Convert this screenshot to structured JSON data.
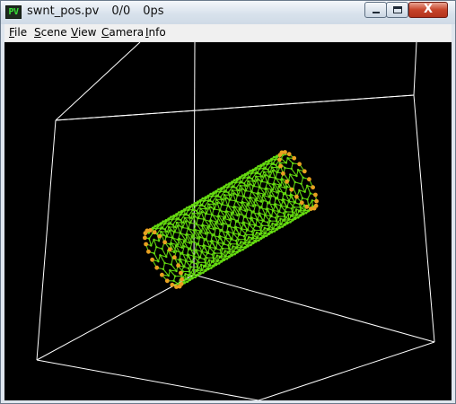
{
  "window": {
    "app_icon_text": "PV",
    "title_segments": [
      "swnt_pos.pv",
      "0/0",
      "0ps"
    ],
    "close_glyph": "X"
  },
  "menu": [
    {
      "accel": "F",
      "rest": "ile"
    },
    {
      "accel": "S",
      "rest": "cene"
    },
    {
      "accel": "V",
      "rest": "iew"
    },
    {
      "accel": "C",
      "rest": "amera"
    },
    {
      "accel": "I",
      "rest": "nfo"
    }
  ],
  "viewport": {
    "background": "#000000",
    "box_color": "#ffffff",
    "bond_color": "#66dd11",
    "atom_color": "#e8a020",
    "scene": "carbon-nanotube-in-bounding-box"
  }
}
